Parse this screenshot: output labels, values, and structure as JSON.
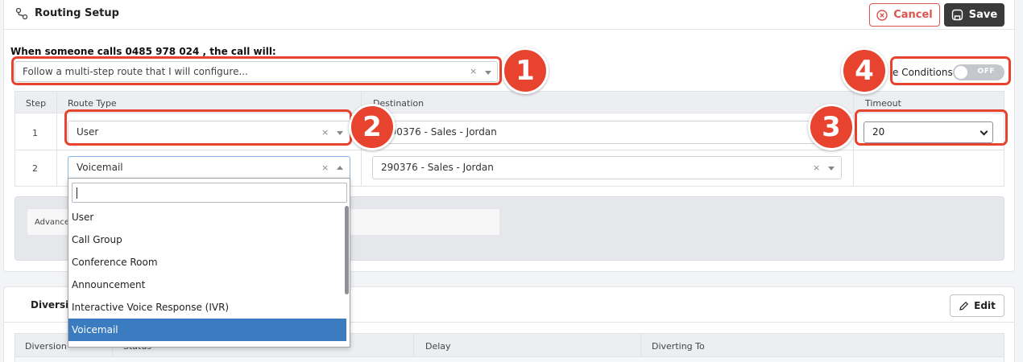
{
  "header": {
    "title": "Routing Setup",
    "cancel_label": "Cancel",
    "save_label": "Save"
  },
  "intro": "When someone calls 0485 978 024 , the call will:",
  "route_mode": {
    "value": "Follow a multi-step route that I will configure...",
    "clear": "×"
  },
  "conditions": {
    "label": "e Conditions",
    "state": "OFF"
  },
  "steps_table": {
    "columns": [
      "Step",
      "Route Type",
      "Destination",
      "Timeout"
    ],
    "rows": [
      {
        "step": "1",
        "route_type": "User",
        "destination": "290376 - Sales - Jordan",
        "timeout": "20"
      },
      {
        "step": "2",
        "route_type": "Voicemail",
        "destination": "290376 - Sales - Jordan",
        "timeout": ""
      }
    ]
  },
  "advanced": {
    "label": "Advance"
  },
  "diversions": {
    "title": "Diversi",
    "edit_label": "Edit",
    "columns": [
      "Diversion",
      "Status",
      "Delay",
      "Diverting To"
    ]
  },
  "dropdown": {
    "options": [
      "User",
      "Call Group",
      "Conference Room",
      "Announcement",
      "Interactive Voice Response (IVR)",
      "Voicemail"
    ],
    "selected": "Voicemail"
  },
  "callouts": [
    "1",
    "2",
    "3",
    "4"
  ],
  "colors": {
    "callout": "#e8432e",
    "cancel": "#d9534f",
    "save_bg": "#3a3a3a",
    "selected_option": "#3a7cbf"
  }
}
